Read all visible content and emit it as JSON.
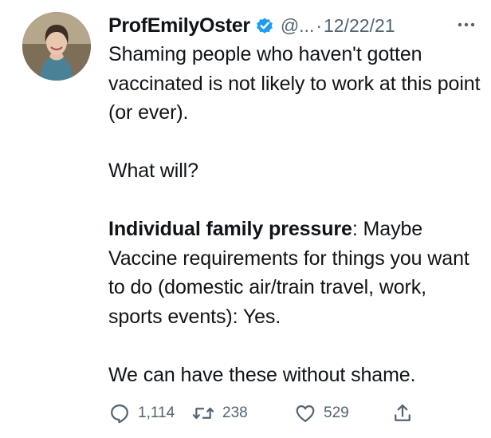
{
  "tweet": {
    "author": {
      "name": "ProfEmilyOster",
      "handle": "@...",
      "separator": "·",
      "date": "12/22/21",
      "verified": true
    },
    "text": {
      "paragraph1": "Shaming people who haven't gotten vaccinated is not likely to work at this point (or ever).",
      "paragraph2": "What will?",
      "paragraph3_bold": "Individual family pressure",
      "paragraph3_rest": ": Maybe",
      "paragraph4": "Vaccine requirements for things you want to do (domestic air/train travel, work, sports events): Yes.",
      "paragraph5": "We can have these without shame."
    },
    "actions": {
      "replies": "1,114",
      "retweets": "238",
      "likes": "529"
    }
  },
  "icons": {
    "verified": "verified-badge-icon",
    "more": "more-dots-icon",
    "reply": "reply-icon",
    "retweet": "retweet-icon",
    "like": "heart-icon",
    "share": "share-icon"
  },
  "colors": {
    "text": "#0f1419",
    "secondary": "#536471",
    "verified_blue": "#1d9bf0"
  }
}
